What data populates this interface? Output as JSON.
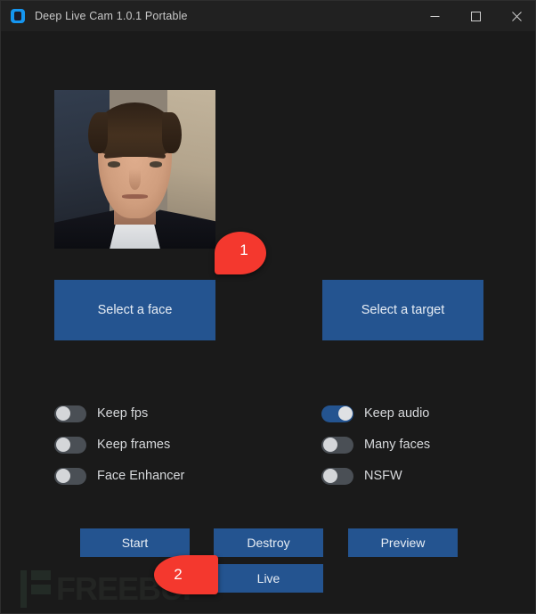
{
  "window": {
    "title": "Deep Live Cam 1.0.1 Portable",
    "app_icon": "app-logo-icon",
    "controls": {
      "minimize": "minimize-icon",
      "maximize": "maximize-icon",
      "close": "close-icon"
    },
    "colors": {
      "titlebar_bg": "#212121",
      "body_bg": "#1a1a1a",
      "accent_blue": "#245490",
      "annotation_red": "#f4382e",
      "toggle_off_track": "#4a4f55",
      "toggle_knob": "#d4d6d9",
      "text": "#d7d9dc"
    }
  },
  "preview": {
    "alt": "selected source face photo"
  },
  "select_buttons": [
    {
      "id": "face",
      "label": "Select a face"
    },
    {
      "id": "target",
      "label": "Select a target"
    }
  ],
  "switches": {
    "left": [
      {
        "id": "keep-fps",
        "label": "Keep fps",
        "on": false
      },
      {
        "id": "keep-frames",
        "label": "Keep frames",
        "on": false
      },
      {
        "id": "face-enhancer",
        "label": "Face Enhancer",
        "on": false
      }
    ],
    "right": [
      {
        "id": "keep-audio",
        "label": "Keep audio",
        "on": true
      },
      {
        "id": "many-faces",
        "label": "Many faces",
        "on": false
      },
      {
        "id": "nsfw",
        "label": "NSFW",
        "on": false
      }
    ]
  },
  "actions": [
    {
      "id": "start",
      "label": "Start"
    },
    {
      "id": "destroy",
      "label": "Destroy"
    },
    {
      "id": "preview",
      "label": "Preview"
    },
    {
      "id": "live",
      "label": "Live"
    }
  ],
  "annotations": [
    {
      "id": "pin-1",
      "number": "1",
      "points_at": "Select a face"
    },
    {
      "id": "pin-2",
      "number": "2",
      "points_at": "Live"
    }
  ],
  "watermark": {
    "text": "FREEBUF"
  }
}
